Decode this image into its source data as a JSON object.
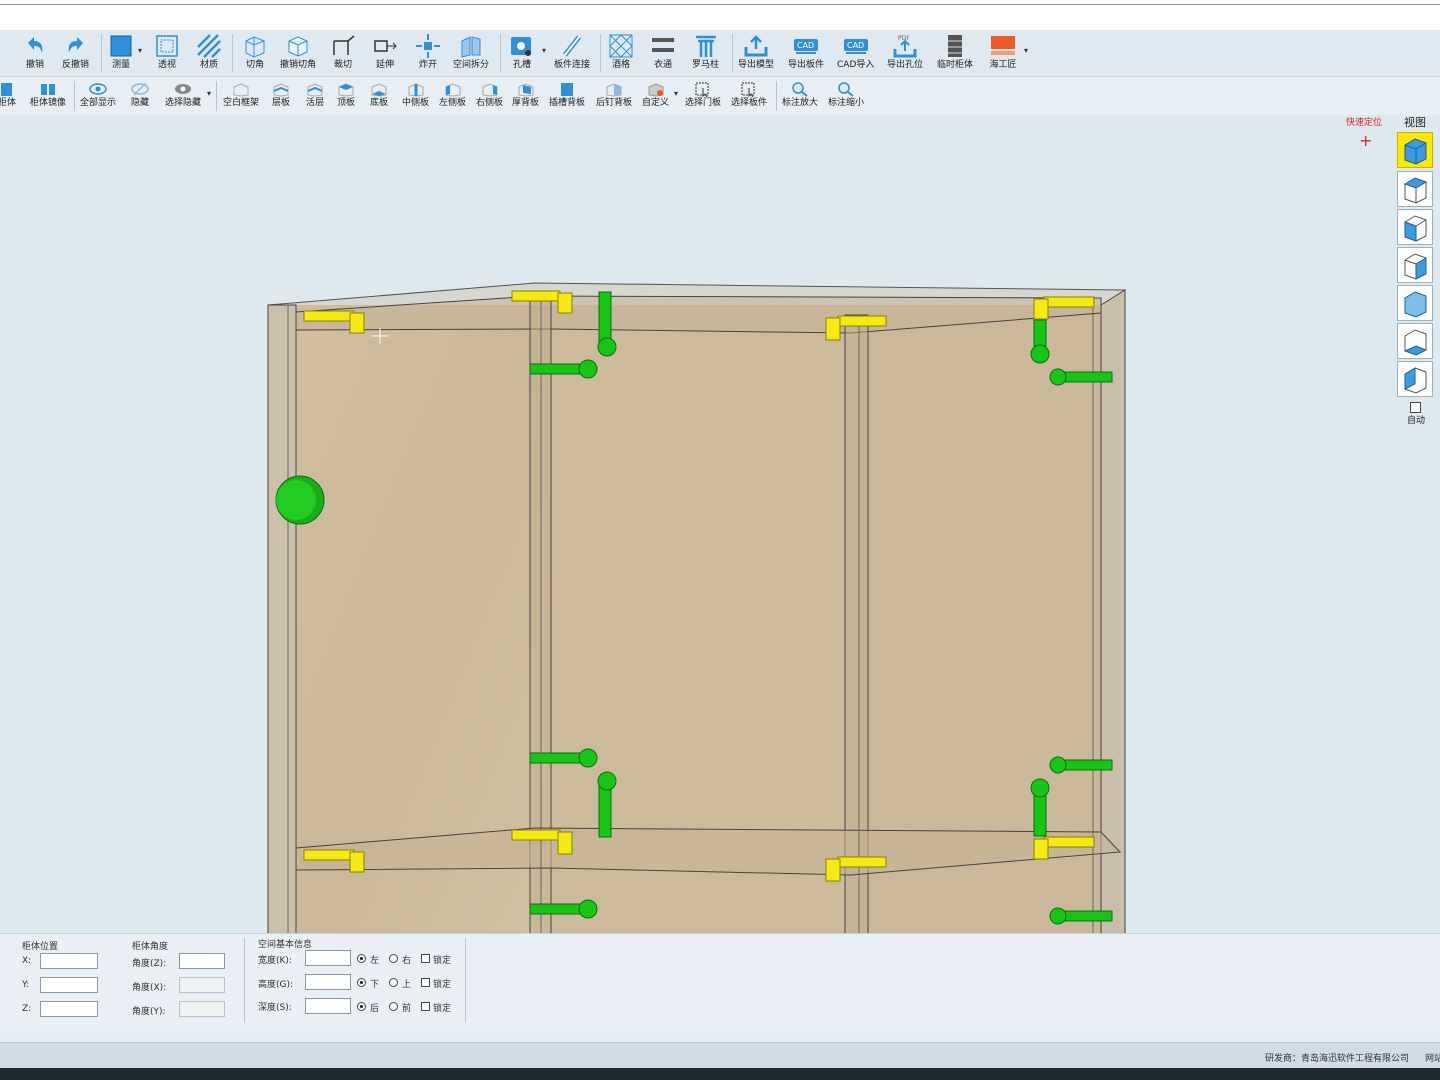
{
  "toolbar1": [
    {
      "label": "撤销",
      "icon": "undo-icon"
    },
    {
      "label": "反撤销",
      "icon": "redo-icon"
    },
    {
      "label": "测量",
      "icon": "measure-icon"
    },
    {
      "label": "透视",
      "icon": "perspective-icon"
    },
    {
      "label": "材质",
      "icon": "material-icon"
    },
    {
      "label": "切角",
      "icon": "chamfer-icon"
    },
    {
      "label": "撤销切角",
      "icon": "undo-chamfer-icon"
    },
    {
      "label": "裁切",
      "icon": "crop-icon"
    },
    {
      "label": "延伸",
      "icon": "extend-icon"
    },
    {
      "label": "炸开",
      "icon": "explode-icon"
    },
    {
      "label": "空间拆分",
      "icon": "space-split-icon"
    },
    {
      "label": "孔槽",
      "icon": "hole-slot-icon"
    },
    {
      "label": "板件连接",
      "icon": "panel-link-icon"
    },
    {
      "label": "酒格",
      "icon": "wine-rack-icon"
    },
    {
      "label": "衣通",
      "icon": "hanging-rod-icon"
    },
    {
      "label": "罗马柱",
      "icon": "roman-column-icon"
    },
    {
      "label": "导出模型",
      "icon": "export-model-icon"
    },
    {
      "label": "导出板件",
      "icon": "export-panel-cad-icon"
    },
    {
      "label": "CAD导入",
      "icon": "cad-import-icon"
    },
    {
      "label": "导出孔位",
      "icon": "export-holes-pdf-icon"
    },
    {
      "label": "临时柜体",
      "icon": "temp-cabinet-icon"
    },
    {
      "label": "海工匠",
      "icon": "haigongjiang-logo-icon"
    }
  ],
  "toolbar2": [
    {
      "label": "柜体",
      "icon": "cabinet-icon"
    },
    {
      "label": "柜体镜像",
      "icon": "cabinet-mirror-icon"
    },
    {
      "label": "全部显示",
      "icon": "show-all-icon"
    },
    {
      "label": "隐藏",
      "icon": "hide-icon"
    },
    {
      "label": "选择隐藏",
      "icon": "select-hide-icon"
    },
    {
      "label": "空白框架",
      "icon": "blank-frame-icon"
    },
    {
      "label": "层板",
      "icon": "shelf-icon"
    },
    {
      "label": "活层",
      "icon": "movable-shelf-icon"
    },
    {
      "label": "顶板",
      "icon": "top-panel-icon"
    },
    {
      "label": "底板",
      "icon": "bottom-panel-icon"
    },
    {
      "label": "中侧板",
      "icon": "middle-side-panel-icon"
    },
    {
      "label": "左侧板",
      "icon": "left-side-panel-icon"
    },
    {
      "label": "右侧板",
      "icon": "right-side-panel-icon"
    },
    {
      "label": "厚背板",
      "icon": "thick-back-panel-icon"
    },
    {
      "label": "插槽背板",
      "icon": "slot-back-panel-icon"
    },
    {
      "label": "后钉背板",
      "icon": "nailed-back-panel-icon"
    },
    {
      "label": "自定义",
      "icon": "custom-icon"
    },
    {
      "label": "选择门板",
      "icon": "select-door-icon"
    },
    {
      "label": "选择板件",
      "icon": "select-panel-icon"
    },
    {
      "label": "标注放大",
      "icon": "zoom-in-icon"
    },
    {
      "label": "标注缩小",
      "icon": "zoom-out-icon"
    }
  ],
  "quick_locate": "快速定位",
  "view_label": "视图",
  "auto_label": "自动",
  "position_panel": {
    "title": "柜体位置",
    "x": "X:",
    "y": "Y:",
    "z": "Z:",
    "x_val": "",
    "y_val": "",
    "z_val": ""
  },
  "angle_panel": {
    "title": "柜体角度",
    "z": "角度(Z):",
    "x": "角度(X):",
    "y": "角度(Y):",
    "z_val": ""
  },
  "space_panel": {
    "title": "空间基本信息",
    "width": "宽度(K):",
    "height": "高度(G):",
    "depth": "深度(S):",
    "left": "左",
    "right": "右",
    "down": "下",
    "up": "上",
    "back": "后",
    "front": "前",
    "lock": "锁定",
    "width_val": "",
    "height_val": "",
    "depth_val": ""
  },
  "status": {
    "developer": "研发商：青岛海迅软件工程有限公司",
    "net": "网站"
  },
  "colors": {
    "accent": "#2f8fd8",
    "hinge_yellow": "#f4ea12",
    "cam_green": "#18c418",
    "panel_wood": "#cbb99a"
  }
}
